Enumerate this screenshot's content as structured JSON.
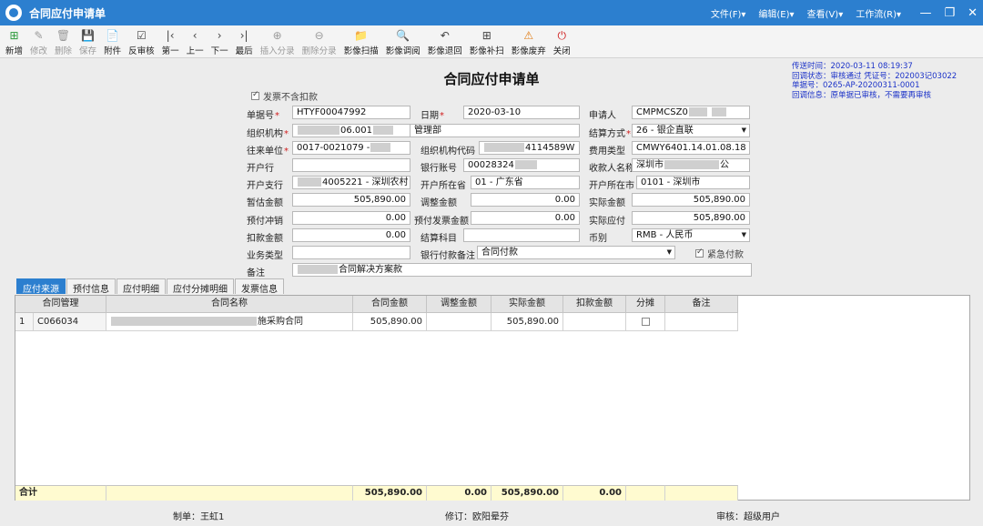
{
  "window": {
    "title": "合同应付申请单",
    "menus": [
      "文件(F)▾",
      "编辑(E)▾",
      "查看(V)▾",
      "工作流(R)▾"
    ],
    "controls": {
      "minimize": "—",
      "restore": "❐",
      "close": "✕"
    }
  },
  "toolbar": [
    {
      "name": "new",
      "label": "新增",
      "icon": "⊞",
      "state": "add"
    },
    {
      "name": "edit",
      "label": "修改",
      "icon": "✎",
      "state": "disabled"
    },
    {
      "name": "delete",
      "label": "删除",
      "icon": "🗑",
      "state": "disabled"
    },
    {
      "name": "save",
      "label": "保存",
      "icon": "💾",
      "state": "disabled"
    },
    {
      "name": "attachment",
      "label": "附件",
      "icon": "📄",
      "state": "normal"
    },
    {
      "name": "unaudit",
      "label": "反审核",
      "icon": "☑",
      "state": "normal"
    },
    {
      "name": "first",
      "label": "第一",
      "icon": "|‹",
      "state": "normal"
    },
    {
      "name": "prev",
      "label": "上一",
      "icon": "‹",
      "state": "normal"
    },
    {
      "name": "next",
      "label": "下一",
      "icon": "›",
      "state": "normal"
    },
    {
      "name": "last",
      "label": "最后",
      "icon": "›|",
      "state": "normal"
    },
    {
      "name": "insert-entry",
      "label": "插入分录",
      "icon": "⊕",
      "state": "disabled"
    },
    {
      "name": "delete-entry",
      "label": "删除分录",
      "icon": "⊖",
      "state": "disabled"
    },
    {
      "name": "image-scan",
      "label": "影像扫描",
      "icon": "📁",
      "state": "normal"
    },
    {
      "name": "image-view",
      "label": "影像调阅",
      "icon": "🔍",
      "state": "normal"
    },
    {
      "name": "image-return",
      "label": "影像退回",
      "icon": "↶",
      "state": "normal"
    },
    {
      "name": "image-rescan",
      "label": "影像补扫",
      "icon": "⊞",
      "state": "normal"
    },
    {
      "name": "image-discard",
      "label": "影像废弃",
      "icon": "⚠",
      "state": "warn"
    },
    {
      "name": "close",
      "label": "关闭",
      "icon": "⏻",
      "state": "close"
    }
  ],
  "form": {
    "title": "合同应付申请单",
    "info": {
      "send_time": "传送时间：2020-03-11  08:19:37",
      "callback": "回调状态：审核通过    凭证号：202003记03022",
      "bill_no": "单据号：0265-AP-20200311-0001",
      "callback_info": "回调信息：原单据已审核，不需要再审核"
    },
    "invoice_no_deduct": {
      "label": "发票不含扣款",
      "checked": true
    },
    "fields": {
      "bill_number": {
        "label": "单据号",
        "value": "HTYF00047992",
        "required": true
      },
      "date": {
        "label": "日期",
        "value": "2020-03-10",
        "required": true
      },
      "applicant": {
        "label": "申请人",
        "value": "CMPMCSZ0"
      },
      "org": {
        "label": "组织机构",
        "value_prefix": "",
        "value_mid": "06.001",
        "value_suffix": "管理部",
        "required": true
      },
      "settle_method": {
        "label": "结算方式",
        "value": "26 - 银企直联",
        "required": true
      },
      "partner": {
        "label": "往来单位",
        "value": "0017-0021079 -",
        "required": true
      },
      "org_code": {
        "label": "组织机构代码",
        "value": "4114589W"
      },
      "expense_type": {
        "label": "费用类型",
        "value": "CMWY6401.14.01.08.18 -"
      },
      "bank": {
        "label": "开户行",
        "value": ""
      },
      "bank_account": {
        "label": "银行账号",
        "value": "00028324"
      },
      "payee_name": {
        "label": "收款人名称",
        "value_prefix": "深圳市",
        "value_suffix": "公"
      },
      "branch": {
        "label": "开户支行",
        "value": "4005221 - 深圳农村"
      },
      "province": {
        "label": "开户所在省",
        "value": "01 - 广东省"
      },
      "city": {
        "label": "开户所在市",
        "value": "0101 - 深圳市"
      },
      "est_amount": {
        "label": "暂估金额",
        "value": "505,890.00"
      },
      "adjust_amount": {
        "label": "调整金额",
        "value": "0.00"
      },
      "actual_amount": {
        "label": "实际金额",
        "value": "505,890.00"
      },
      "prepay_offset": {
        "label": "预付冲销",
        "value": "0.00"
      },
      "prepay_invoice": {
        "label": "预付发票金额",
        "value": "0.00"
      },
      "actual_payable": {
        "label": "实际应付",
        "value": "505,890.00"
      },
      "deduct_amount": {
        "label": "扣款金额",
        "value": "0.00"
      },
      "settle_subject": {
        "label": "结算科目",
        "value": ""
      },
      "currency": {
        "label": "币别",
        "value": "RMB - 人民币"
      },
      "biz_type": {
        "label": "业务类型",
        "value": ""
      },
      "bank_remark": {
        "label": "银行付款备注",
        "value": "合同付款"
      },
      "urgent": {
        "label": "紧急付款",
        "checked": true
      },
      "remark": {
        "label": "备注",
        "value_suffix": "合同解决方案款"
      }
    }
  },
  "tabs": [
    "应付来源",
    "预付信息",
    "应付明细",
    "应付分摊明细",
    "发票信息"
  ],
  "grid": {
    "columns": [
      "合同管理",
      "合同名称",
      "合同金额",
      "调整金额",
      "实际金额",
      "扣款金额",
      "分摊",
      "备注"
    ],
    "rows": [
      {
        "index": "1",
        "contract": "C066034",
        "name_suffix": "施采购合同",
        "amount": "505,890.00",
        "adjust": "",
        "actual": "505,890.00",
        "deduct": "",
        "split": false,
        "remark": ""
      }
    ],
    "footer": {
      "label": "合计",
      "amount": "505,890.00",
      "adjust": "0.00",
      "actual": "505,890.00",
      "deduct": "0.00"
    }
  },
  "bottom": {
    "maker": "制单：王虹1",
    "modifier": "修订：欧阳晕芬",
    "auditor": "审核：超级用户"
  }
}
